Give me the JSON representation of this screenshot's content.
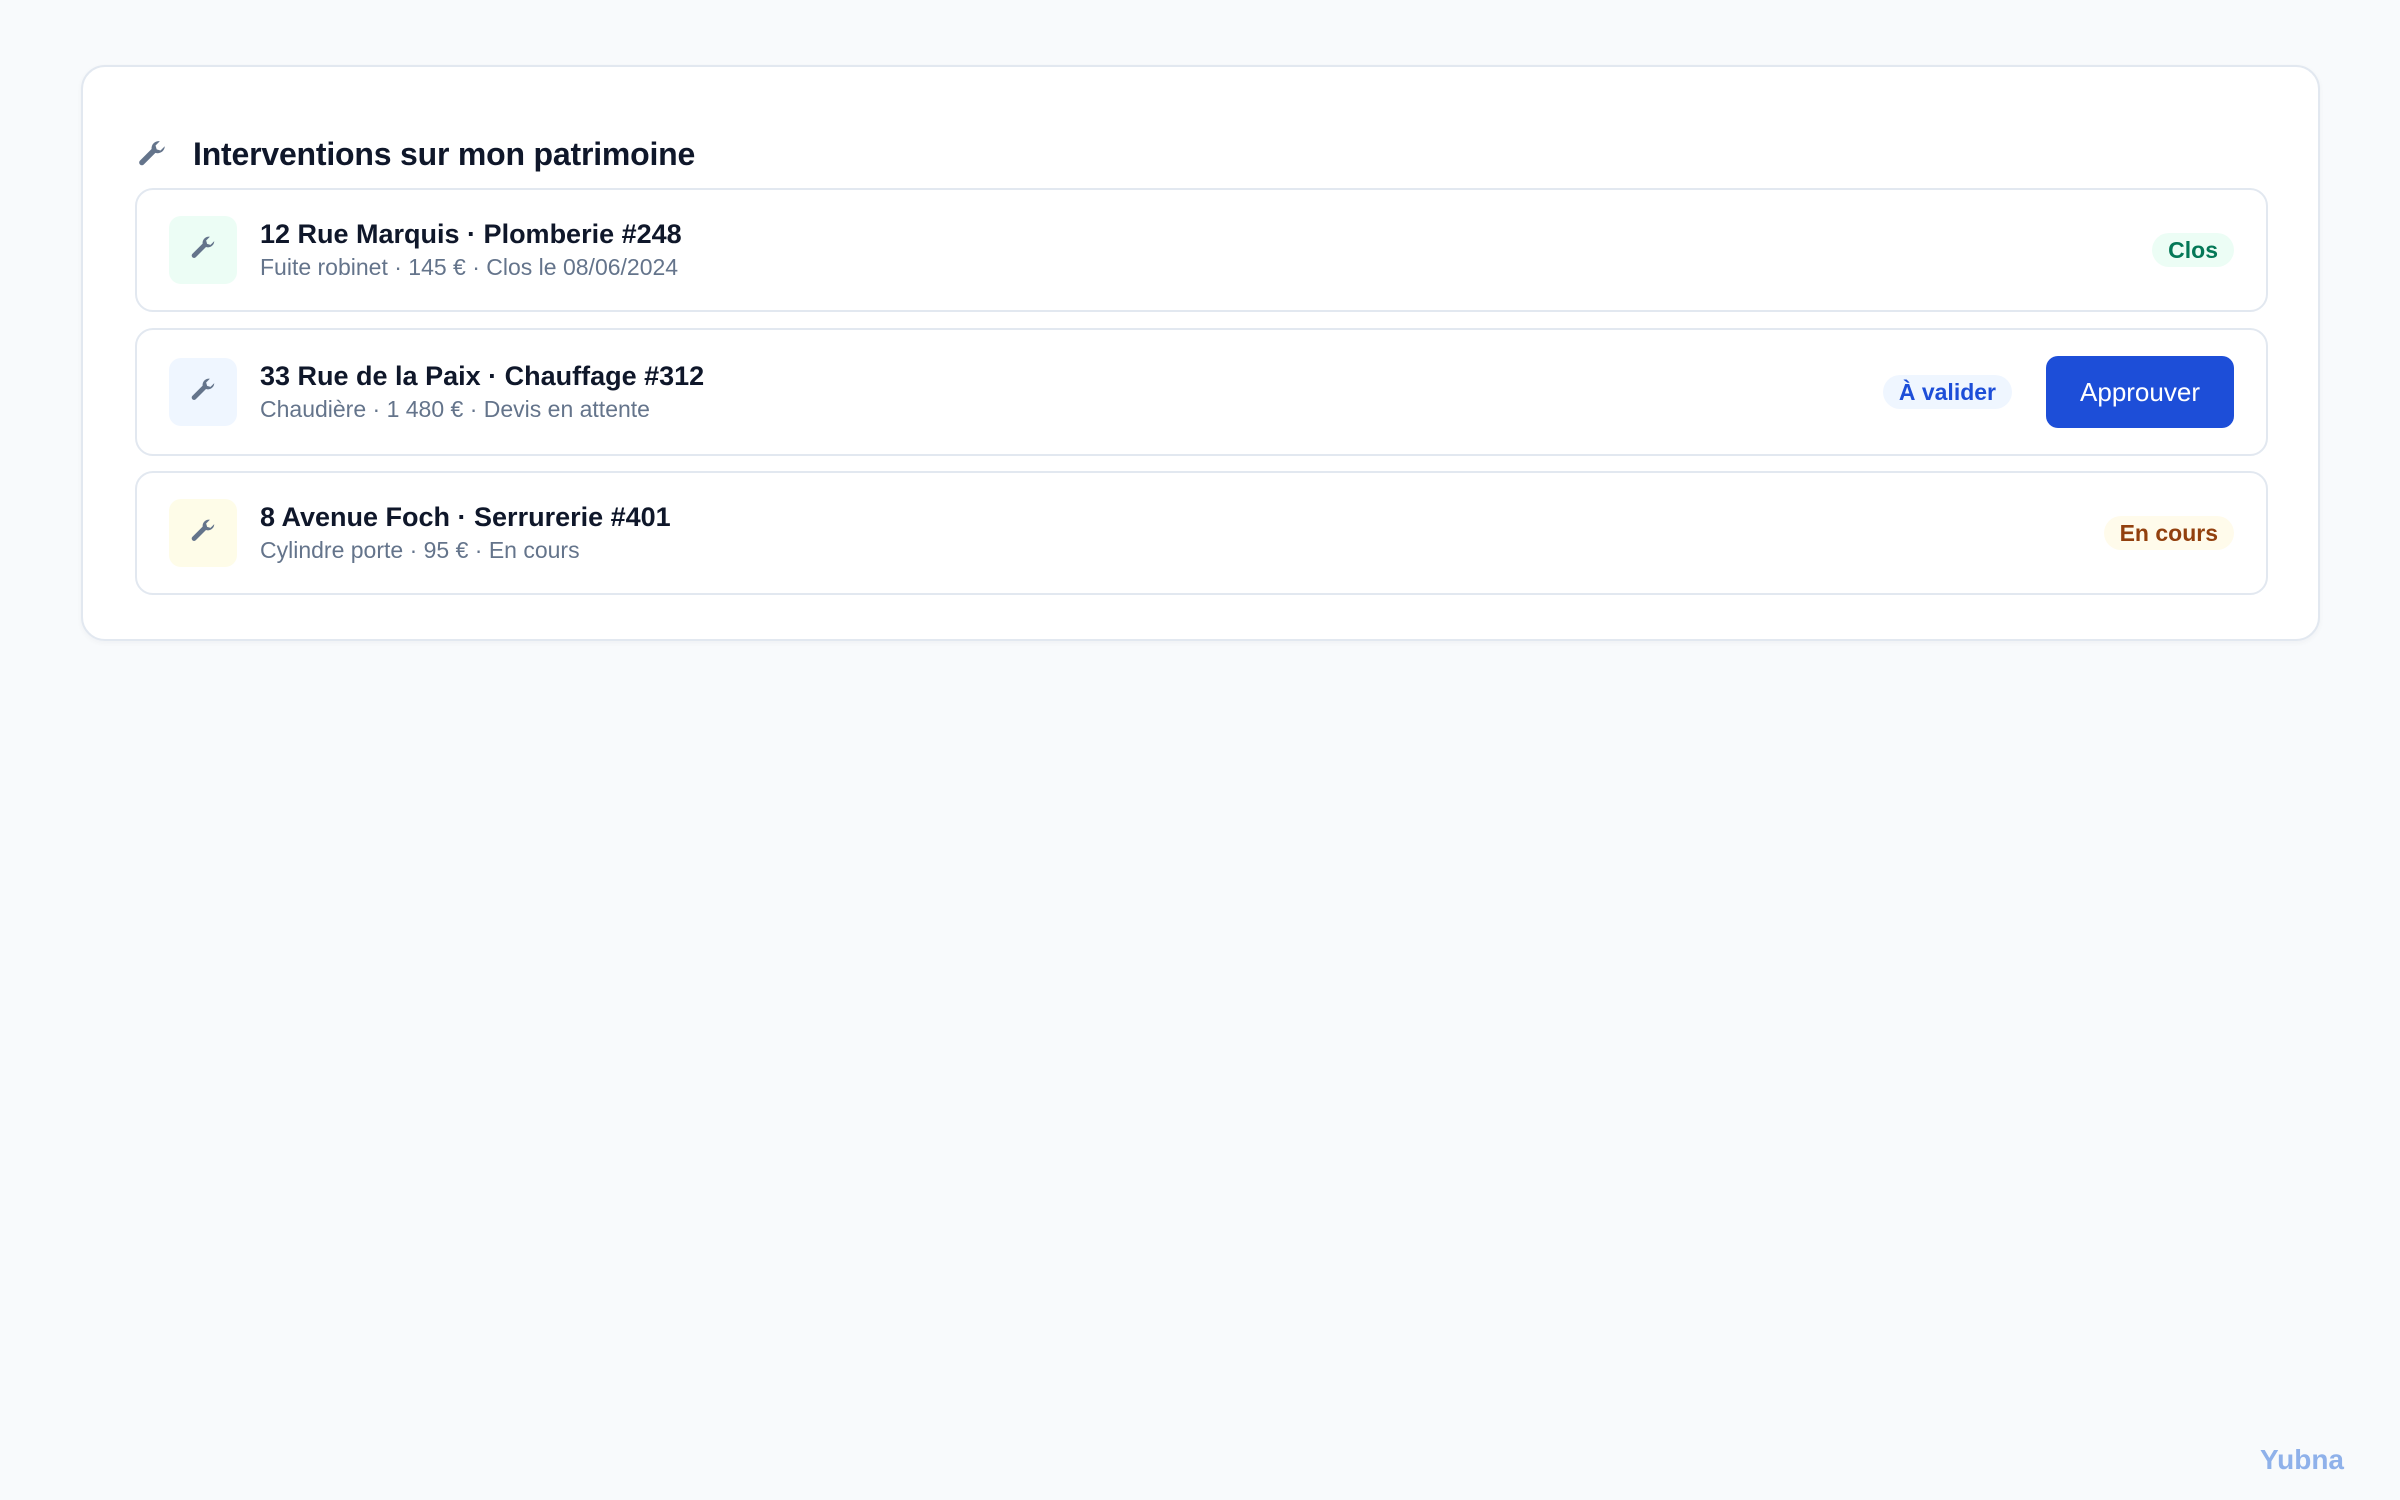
{
  "panel": {
    "title": "Interventions sur mon patrimoine",
    "icon": "wrench-icon"
  },
  "interventions": [
    {
      "title": "12 Rue Marquis · Plomberie #248",
      "subtitle": "Fuite robinet · 145 € · Clos le 08/06/2024",
      "status": "Clos",
      "status_color": "#047857",
      "icon": "wrench-icon",
      "icon_bg": "#ecfdf5"
    },
    {
      "title": "33 Rue de la Paix · Chauffage #312",
      "subtitle": "Chaudière · 1 480 € · Devis en attente",
      "status": "À valider",
      "status_color": "#1d4ed8",
      "icon": "wrench-icon",
      "icon_bg": "#eff6ff",
      "action_label": "Approuver"
    },
    {
      "title": "8 Avenue Foch · Serrurerie #401",
      "subtitle": "Cylindre porte · 95 € · En cours",
      "status": "En cours",
      "status_color": "#92400e",
      "icon": "wrench-icon",
      "icon_bg": "#fefce8"
    }
  ],
  "brand": "Yubna",
  "colors": {
    "primary": "#1d4ed8",
    "page_bg": "#f8fafc",
    "border": "#e2e8f0"
  }
}
